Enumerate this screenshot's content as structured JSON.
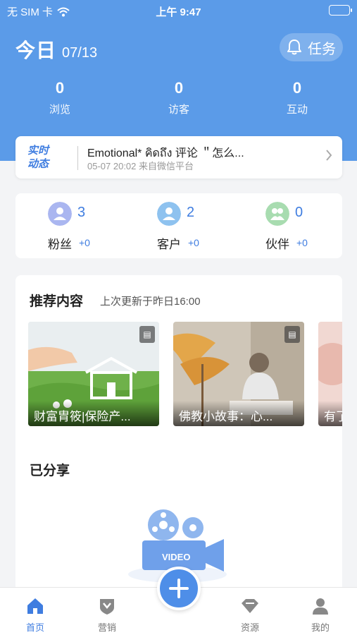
{
  "status_bar": {
    "carrier": "无 SIM 卡",
    "time": "上午 9:47"
  },
  "header": {
    "today_label": "今日",
    "date": "07/13",
    "task_button": "任务",
    "stats": [
      {
        "value": "0",
        "label": "浏览"
      },
      {
        "value": "0",
        "label": "访客"
      },
      {
        "value": "0",
        "label": "互动"
      }
    ]
  },
  "realtime": {
    "tag_line1": "实时",
    "tag_line2": "动态",
    "message": "Emotional* คิดถึง 评论 ＂怎么...",
    "meta": "05-07 20:02 来自微信平台"
  },
  "relations": [
    {
      "count": "3",
      "label": "粉丝",
      "delta": "+0",
      "icon": "fans-icon"
    },
    {
      "count": "2",
      "label": "客户",
      "delta": "+0",
      "icon": "customer-icon"
    },
    {
      "count": "0",
      "label": "伙伴",
      "delta": "+0",
      "icon": "partner-icon"
    }
  ],
  "recommend": {
    "title": "推荐内容",
    "subtitle": "上次更新于昨日16:00",
    "items": [
      {
        "caption": "财富胄筱|保险产..."
      },
      {
        "caption": "佛教小故事：心..."
      },
      {
        "caption": "有了"
      }
    ]
  },
  "shared": {
    "title": "已分享",
    "video_label": "VIDEO"
  },
  "tabbar": {
    "tabs": [
      {
        "label": "首页"
      },
      {
        "label": "营销"
      },
      {
        "label": "资源"
      },
      {
        "label": "我的"
      }
    ]
  },
  "colors": {
    "primary": "#5b9be8",
    "accent": "#3f7de0"
  }
}
